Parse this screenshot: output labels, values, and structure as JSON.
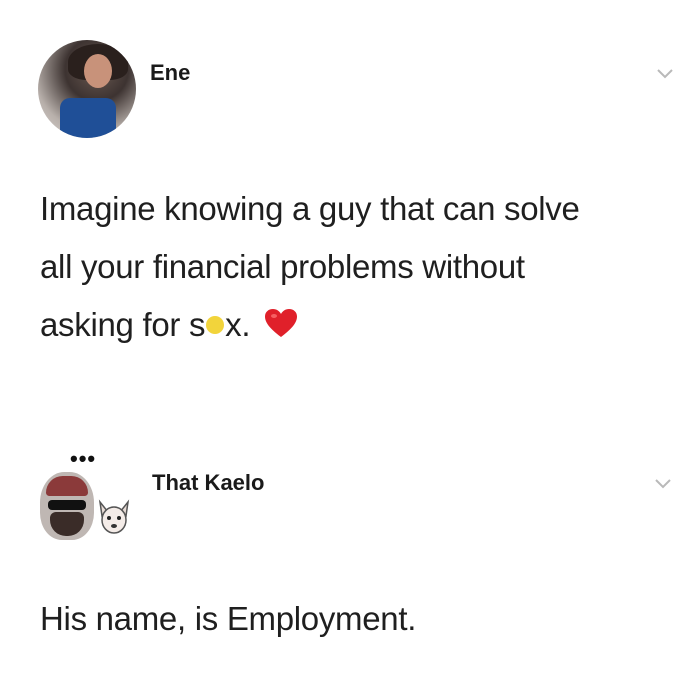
{
  "tweets": [
    {
      "author": "Ene",
      "lines": [
        "Imagine knowing a guy that can solve",
        "all your financial problems without",
        "asking for s",
        "x."
      ],
      "avatar_icon": "woman-portrait-avatar",
      "end_emoji": "red-heart-icon"
    },
    {
      "author": "That Kaelo",
      "text": "His name, is Employment.",
      "avatar_icon": "man-with-cap-avatar",
      "sticker_icon": "dog-sticker-icon",
      "dots": "•••"
    }
  ],
  "colors": {
    "background": "#ffffff",
    "text": "#1f1f1f",
    "heart": "#e0202a",
    "chevron": "#b9b9b9"
  }
}
